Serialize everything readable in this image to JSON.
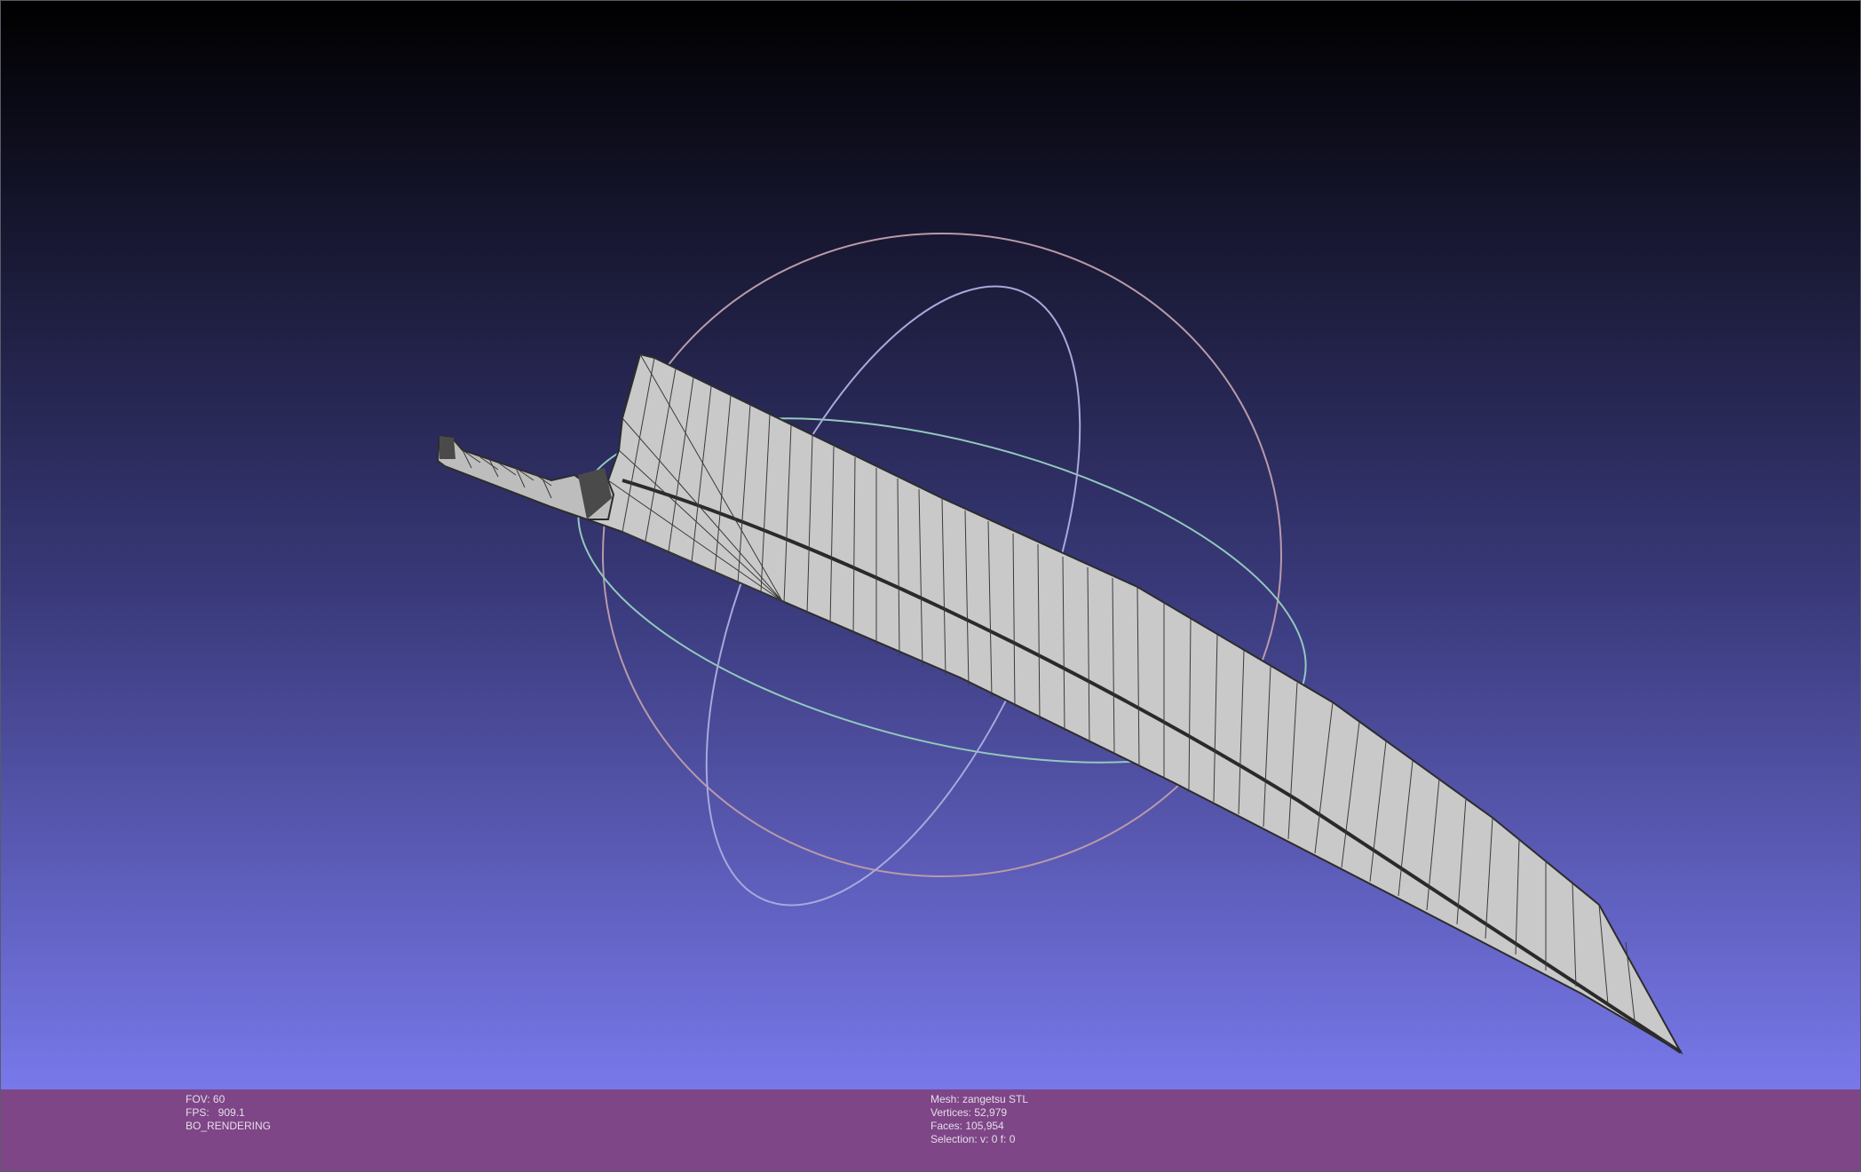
{
  "colors": {
    "background_top": "#000000",
    "background_mid": "#2d2d5c",
    "background_bottom": "#7878ea",
    "info_bar": "#7e4687",
    "info_text": "#e6dcea",
    "mesh_fill": "#c8c8c8",
    "mesh_edge": "#3a3a3a",
    "trackball_red": "#c89aa6",
    "trackball_green": "#9ad0c0",
    "trackball_blue": "#a8a8e0"
  },
  "scene": {
    "object_icon": "mesh-wireframe",
    "trackball_icon": "trackball-rings"
  },
  "status_left": {
    "fov": "FOV: 60",
    "fps": "FPS:   909.1",
    "mode": "BO_RENDERING"
  },
  "status_right": {
    "mesh": "Mesh: zangetsu STL",
    "vertices": "Vertices: 52,979",
    "faces": "Faces: 105,954",
    "selection": "Selection: v: 0 f: 0"
  }
}
